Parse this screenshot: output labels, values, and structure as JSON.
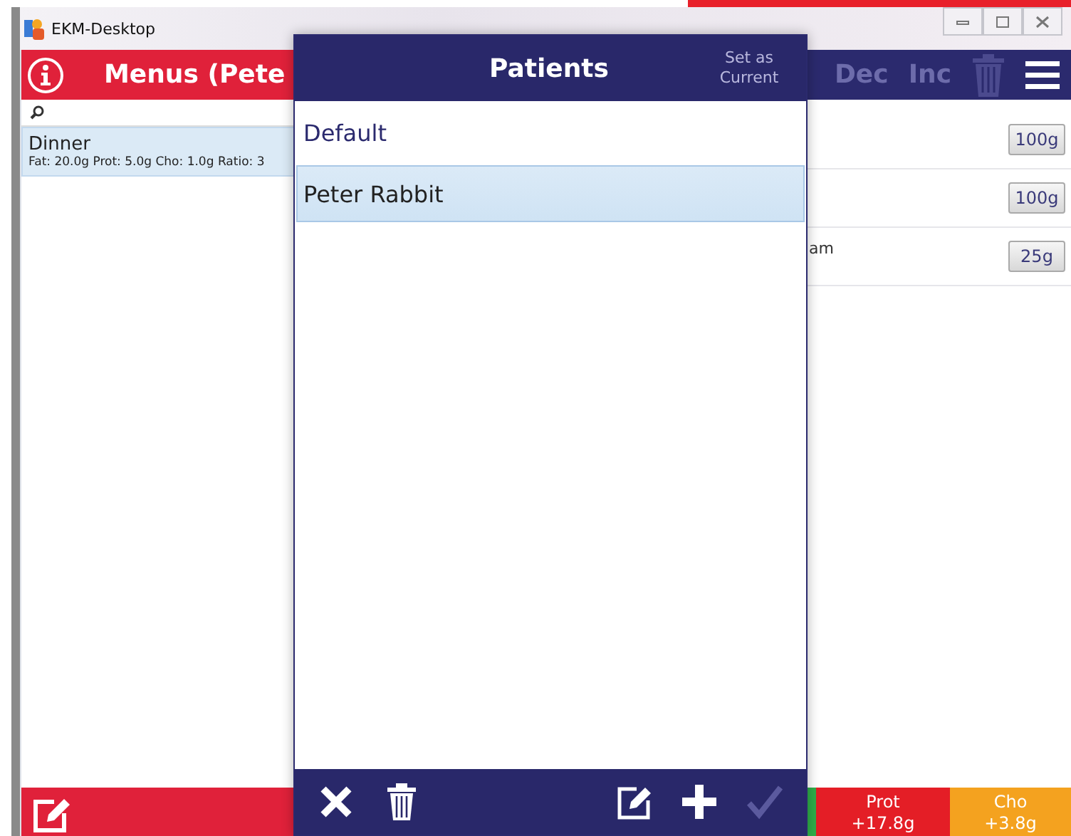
{
  "window": {
    "title": "EKM-Desktop"
  },
  "app_header": {
    "title": "Menus (Pete",
    "actions": [
      "Dec",
      "Inc"
    ]
  },
  "menus": [
    {
      "name": "Dinner",
      "details": "Fat: 20.0g Prot: 5.0g Cho: 1.0g Ratio: 3",
      "selected": true
    }
  ],
  "food_rows": [
    {
      "amount": "100g"
    },
    {
      "amount": "100g"
    },
    {
      "name": "am",
      "amount": "25g"
    }
  ],
  "totals": [
    {
      "color": "#2fae4a"
    },
    {
      "label": "Prot",
      "value": "+17.8g",
      "color": "#e41e26"
    },
    {
      "label": "Cho",
      "value": "+3.8g",
      "color": "#f4a21f"
    }
  ],
  "dialog": {
    "title": "Patients",
    "header_action": "Set as Current",
    "patients": [
      {
        "name": "Default",
        "selected": false
      },
      {
        "name": "Peter Rabbit",
        "selected": true
      }
    ],
    "toolbar": [
      {
        "kind": "close",
        "disabled": false
      },
      {
        "kind": "delete",
        "disabled": false
      },
      {
        "kind": "edit",
        "disabled": false
      },
      {
        "kind": "add",
        "disabled": false
      },
      {
        "kind": "confirm",
        "disabled": true
      }
    ]
  }
}
